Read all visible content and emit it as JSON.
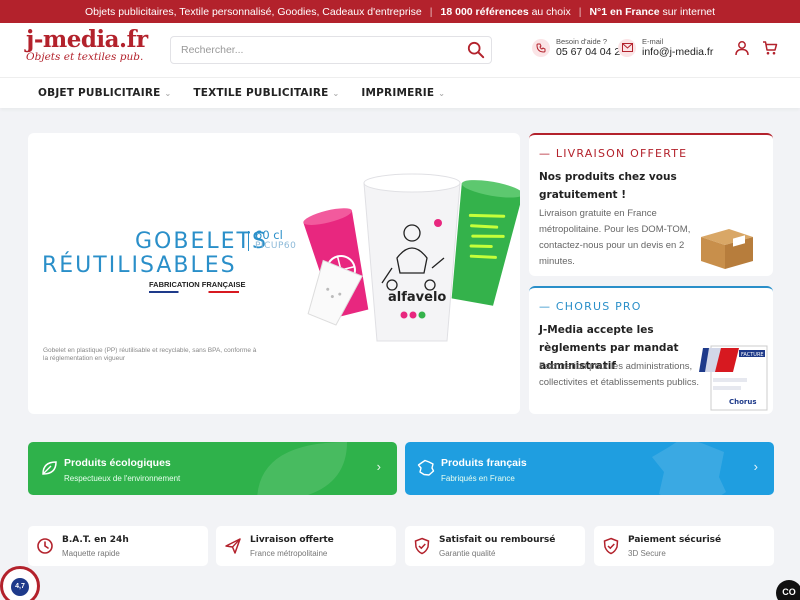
{
  "topbar": {
    "text1": "Objets publicitaires, Textile personnalisé, Goodies, Cadeaux d'entreprise",
    "sep": "|",
    "refs_bold": "18 000 références",
    "refs_rest": " au choix",
    "first_bold": "N°1 en France",
    "first_rest": " sur internet"
  },
  "header": {
    "logo_main": "j-media.fr",
    "logo_tag": "Objets et textiles pub.",
    "search_placeholder": "Rechercher...",
    "help_label": "Besoin d'aide ?",
    "phone": "05 67 04 04 24",
    "email_label": "E-mail",
    "email": "info@j-media.fr"
  },
  "nav": {
    "items": [
      {
        "label": "OBJET PUBLICITAIRE"
      },
      {
        "label": "TEXTILE PUBLICITAIRE"
      },
      {
        "label": "IMPRIMERIE"
      }
    ],
    "chevron": "⌄"
  },
  "hero": {
    "title_line1": "GOBELETS",
    "title_line2": "RÉUTILISABLES",
    "volume": "60 cl",
    "ref": "PICUP60",
    "made_in": "FABRICATION FRANÇAISE",
    "desc": "Gobelet en plastique (PP) réutilisable et recyclable, sans BPA, conforme à la réglementation en vigueur",
    "cup_brand": "alfavelo"
  },
  "livraison_card": {
    "heading": "LIVRAISON OFFERTE",
    "title": "Nos produits chez vous gratuitement !",
    "text": "Livraison gratuite en France métropolitaine. Pour les DOM-TOM, contactez-nous pour un devis en 2 minutes."
  },
  "chorus_card": {
    "heading": "CHORUS PRO",
    "title": "J-Media accepte les règlements par mandat administratif",
    "text": "Facturation pour les administrations, collectivites et établissements publics.",
    "img_label_facture": "FACTURE",
    "img_label_chorus": "Chorus"
  },
  "categories": [
    {
      "title": "Produits écologiques",
      "subtitle": "Respectueux de l'environnement",
      "color": "#2fb24b"
    },
    {
      "title": "Produits français",
      "subtitle": "Fabriqués en France",
      "color": "#1f9ee0"
    }
  ],
  "features": [
    {
      "title": "B.A.T. en 24h",
      "subtitle": "Maquette rapide"
    },
    {
      "title": "Livraison offerte",
      "subtitle": "France métropolitaine"
    },
    {
      "title": "Satisfait ou remboursé",
      "subtitle": "Garantie qualité"
    },
    {
      "title": "Paiement sécurisé",
      "subtitle": "3D Secure"
    }
  ],
  "arrow": "›",
  "badge_text": "4,7",
  "cc_text": "CO",
  "colors": {
    "brand": "#b3222c",
    "blue": "#2a8fc9",
    "green": "#2fb24b",
    "lightblue": "#1f9ee0"
  }
}
